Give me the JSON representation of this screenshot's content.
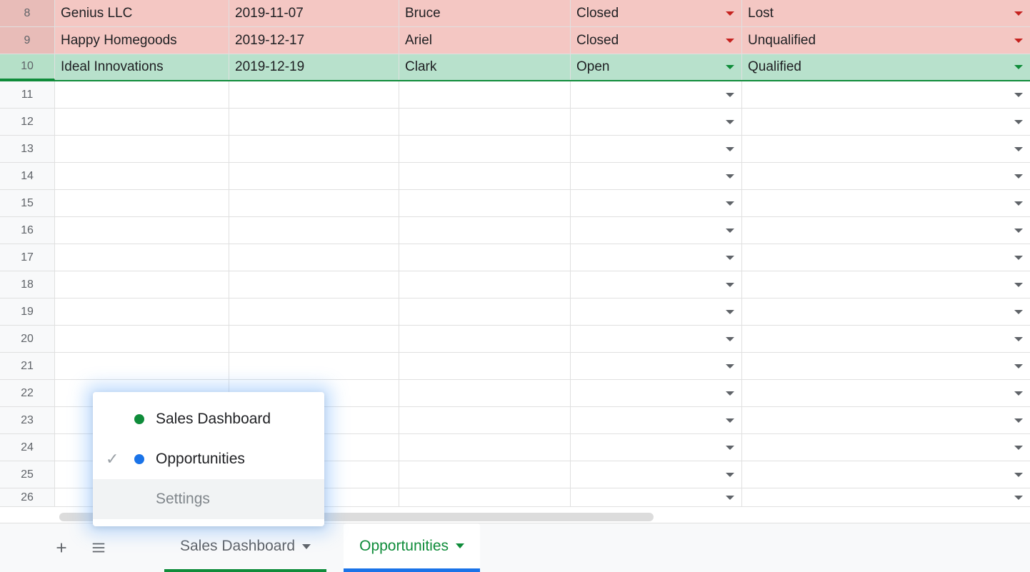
{
  "rows": [
    {
      "num": "8",
      "tone": "red",
      "company": "Genius LLC",
      "date": "2019-11-07",
      "owner": "Bruce",
      "status": "Closed",
      "stage": "Lost"
    },
    {
      "num": "9",
      "tone": "red",
      "company": "Happy Homegoods",
      "date": "2019-12-17",
      "owner": "Ariel",
      "status": "Closed",
      "stage": "Unqualified"
    },
    {
      "num": "10",
      "tone": "green",
      "company": "Ideal Innovations",
      "date": "2019-12-19",
      "owner": "Clark",
      "status": "Open",
      "stage": "Qualified"
    }
  ],
  "empty_rows": [
    "11",
    "12",
    "13",
    "14",
    "15",
    "16",
    "17",
    "18",
    "19",
    "20",
    "21",
    "22",
    "23",
    "24",
    "25",
    "26"
  ],
  "tabs": {
    "sales": "Sales Dashboard",
    "opps": "Opportunities"
  },
  "popup": {
    "sales": "Sales Dashboard",
    "opps": "Opportunities",
    "settings": "Settings"
  }
}
